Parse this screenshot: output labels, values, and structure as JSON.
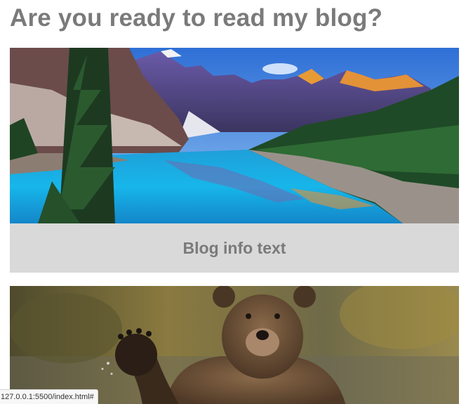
{
  "page": {
    "heading": "Are you ready to read my blog?"
  },
  "posts": [
    {
      "image": "mountain-lake-landscape",
      "info": "Blog info text"
    },
    {
      "image": "waving-bear-photo",
      "info": ""
    }
  ],
  "status_bar": {
    "url": "127.0.0.1:5500/index.html#"
  },
  "colors": {
    "heading_text": "#7a7a7a",
    "info_background": "#d9d9d9",
    "info_text": "#7a7a7a"
  }
}
